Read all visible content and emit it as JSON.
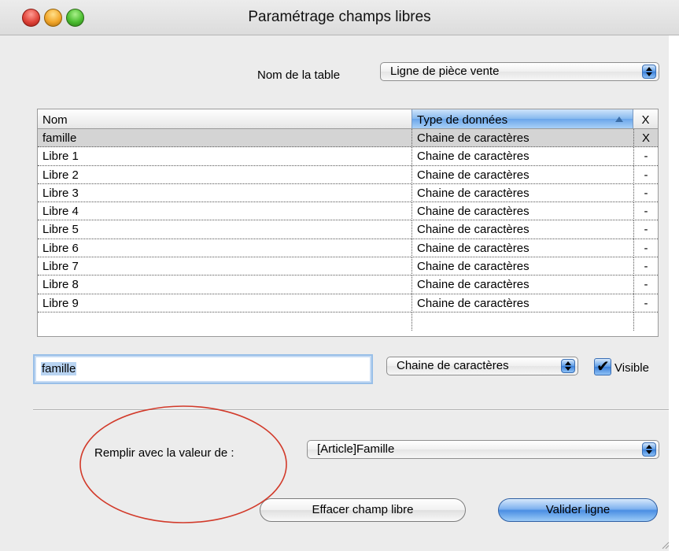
{
  "window": {
    "title": "Paramétrage champs libres"
  },
  "table_name": {
    "label": "Nom de la table",
    "selected": "Ligne de pièce vente"
  },
  "fields_table": {
    "columns": [
      "Nom",
      "Type de données",
      "X"
    ],
    "sorted_column": "Type de données",
    "rows": [
      {
        "name": "famille",
        "type": "Chaine de caractères",
        "visible": "X"
      },
      {
        "name": "Libre 1",
        "type": "Chaine de caractères",
        "visible": "-"
      },
      {
        "name": "Libre 2",
        "type": "Chaine de caractères",
        "visible": "-"
      },
      {
        "name": "Libre 3",
        "type": "Chaine de caractères",
        "visible": "-"
      },
      {
        "name": "Libre 4",
        "type": "Chaine de caractères",
        "visible": "-"
      },
      {
        "name": "Libre 5",
        "type": "Chaine de caractères",
        "visible": "-"
      },
      {
        "name": "Libre 6",
        "type": "Chaine de caractères",
        "visible": "-"
      },
      {
        "name": "Libre 7",
        "type": "Chaine de caractères",
        "visible": "-"
      },
      {
        "name": "Libre 8",
        "type": "Chaine de caractères",
        "visible": "-"
      },
      {
        "name": "Libre 9",
        "type": "Chaine de caractères",
        "visible": "-"
      }
    ],
    "selected_row": 0
  },
  "editor": {
    "name_value": "famille",
    "type_selected": "Chaine de caractères",
    "visible_label": "Visible",
    "visible_checked": true
  },
  "fill": {
    "label": "Remplir avec la valeur de :",
    "selected": "[Article]Famille"
  },
  "buttons": {
    "clear": "Effacer champ libre",
    "validate": "Valider ligne"
  },
  "colors": {
    "annotation": "#d23a2a",
    "accent": "#4a8ee3"
  }
}
